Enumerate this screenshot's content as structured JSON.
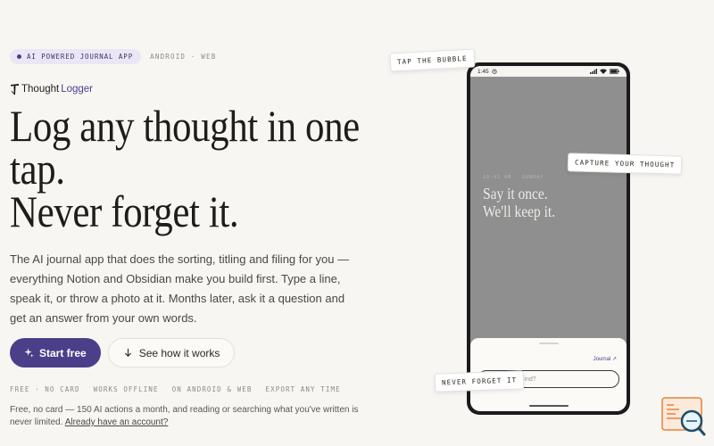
{
  "badge": {
    "label": "AI POWERED JOURNAL APP"
  },
  "platforms": "ANDROID · WEB",
  "logo": {
    "part1": "Thought",
    "part2": "Logger"
  },
  "headline": {
    "line1": "Log any thought in one",
    "line2": "tap.",
    "line3": "Never forget it."
  },
  "lead": "The AI journal app that does the sorting, titling and filing for you — everything Notion and Obsidian make you build first. Type a line, speak it, or throw a photo at it. Months later, ask it a question and get an answer from your own words.",
  "cta": {
    "primary": "Start free",
    "secondary": "See how it works"
  },
  "features": [
    "FREE · NO CARD",
    "WORKS OFFLINE",
    "ON ANDROID & WEB",
    "EXPORT ANY TIME"
  ],
  "fineprint": {
    "text": "Free, no card — 150 AI actions a month, and reading or searching what you've written is never limited. ",
    "link": "Already have an account?"
  },
  "phone": {
    "time": "1:45",
    "entry_meta": "10:42 AM · SUNDAY",
    "entry_line1": "Say it once.",
    "entry_line2": "We'll keep it.",
    "journal_link": "Journal ↗",
    "input_placeholder": "your mind?"
  },
  "callouts": {
    "tap": "TAP THE BUBBLE",
    "capture": "CAPTURE YOUR THOUGHT",
    "never": "NEVER FORGET IT"
  },
  "colors": {
    "accent": "#4b3f8a",
    "background": "#f8f6f2",
    "screen": "#8e8f8e"
  }
}
